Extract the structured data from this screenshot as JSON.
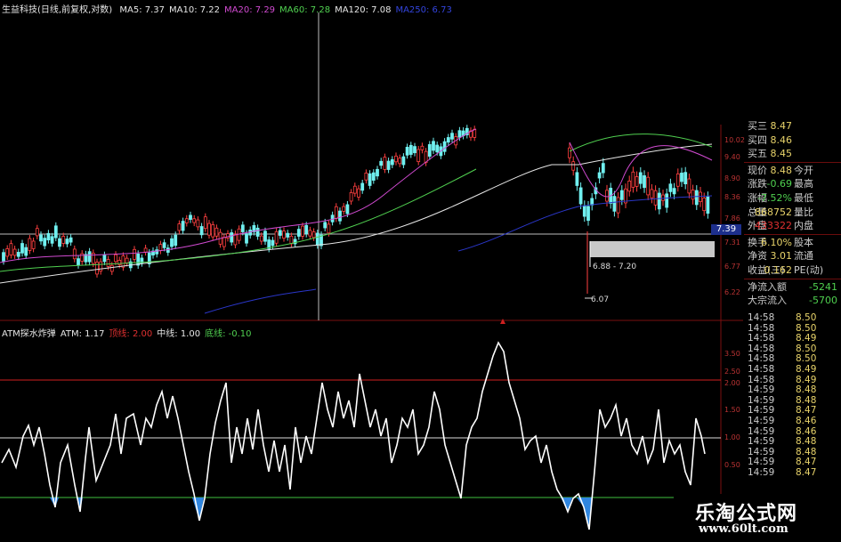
{
  "legend": {
    "title": "生益科技(日线,前复权,对数)",
    "ma": [
      {
        "label": "MA5: 7.37",
        "color": "#e6e6e6"
      },
      {
        "label": "MA10: 7.22",
        "color": "#e6e6e6"
      },
      {
        "label": "MA20: 7.29",
        "color": "#d04ad0"
      },
      {
        "label": "MA60: 7.28",
        "color": "#50d050"
      },
      {
        "label": "MA120: 7.08",
        "color": "#e6e6e6"
      },
      {
        "label": "MA250: 6.73",
        "color": "#3344dd"
      }
    ]
  },
  "indicator_legend": [
    {
      "label": "ATM探水炸弹",
      "color": "#e6e6e6"
    },
    {
      "label": "ATM: 1.17",
      "color": "#e6e6e6"
    },
    {
      "label": "顶线: 2.00",
      "color": "#e03030"
    },
    {
      "label": "中线: 1.00",
      "color": "#e6e6e6"
    },
    {
      "label": "底线: -0.10",
      "color": "#50d050"
    }
  ],
  "price_axis": [
    "10.02",
    "9.40",
    "8.90",
    "8.36",
    "7.86",
    "7.31",
    "6.77",
    "6.22"
  ],
  "ind_axis": [
    "3.50",
    "2.50",
    "2.00",
    "1.50",
    "1.00",
    "0.50"
  ],
  "annotations": {
    "range": "6.88 - 7.20",
    "low": "6.07",
    "price_tag": "7.39"
  },
  "quote": {
    "bids": [
      {
        "label": "买三",
        "value": "8.47"
      },
      {
        "label": "买四",
        "value": "8.46"
      },
      {
        "label": "买五",
        "value": "8.45"
      }
    ],
    "rows": [
      {
        "l1": "现价",
        "v1": "8.48",
        "l2": "今开",
        "v2": "",
        "c1": "#e8d36a"
      },
      {
        "l1": "涨跌",
        "v1": "-0.69",
        "l2": "最高",
        "v2": "",
        "c1": "#4fd04f"
      },
      {
        "l1": "涨幅",
        "v1": "-7.52%",
        "l2": "最低",
        "v2": "",
        "c1": "#4fd04f"
      },
      {
        "l1": "总量",
        "v1": "868752",
        "l2": "量比",
        "v2": "",
        "c1": "#e8d36a"
      },
      {
        "l1": "外盘",
        "v1": "433322",
        "l2": "内盘",
        "v2": "",
        "c1": "#e03030"
      }
    ],
    "rows2": [
      {
        "l1": "换手",
        "v1": "6.10%",
        "l2": "股本",
        "c1": "#e8d36a"
      },
      {
        "l1": "净资",
        "v1": "3.01",
        "l2": "流通",
        "c1": "#e8d36a"
      },
      {
        "l1": "收益(三)",
        "v1": "0.162",
        "l2": "PE(动)",
        "c1": "#e8d36a"
      }
    ],
    "flows": [
      {
        "label": "净流入额",
        "value": "-5241"
      },
      {
        "label": "大宗流入",
        "value": "-5700"
      }
    ]
  },
  "trades": [
    {
      "time": "14:58",
      "price": "8.50"
    },
    {
      "time": "14:58",
      "price": "8.50"
    },
    {
      "time": "14:58",
      "price": "8.49"
    },
    {
      "time": "14:58",
      "price": "8.50"
    },
    {
      "time": "14:58",
      "price": "8.50"
    },
    {
      "time": "14:58",
      "price": "8.49"
    },
    {
      "time": "14:58",
      "price": "8.49"
    },
    {
      "time": "14:59",
      "price": "8.48"
    },
    {
      "time": "14:59",
      "price": "8.48"
    },
    {
      "time": "14:59",
      "price": "8.47"
    },
    {
      "time": "14:59",
      "price": "8.46"
    },
    {
      "time": "14:59",
      "price": "8.46"
    },
    {
      "time": "14:59",
      "price": "8.48"
    },
    {
      "time": "14:59",
      "price": "8.48"
    },
    {
      "time": "14:59",
      "price": "8.47"
    },
    {
      "time": "14:59",
      "price": "8.47"
    }
  ],
  "watermark": {
    "line1": "乐淘公式网",
    "line2": "www.60lt.com"
  }
}
